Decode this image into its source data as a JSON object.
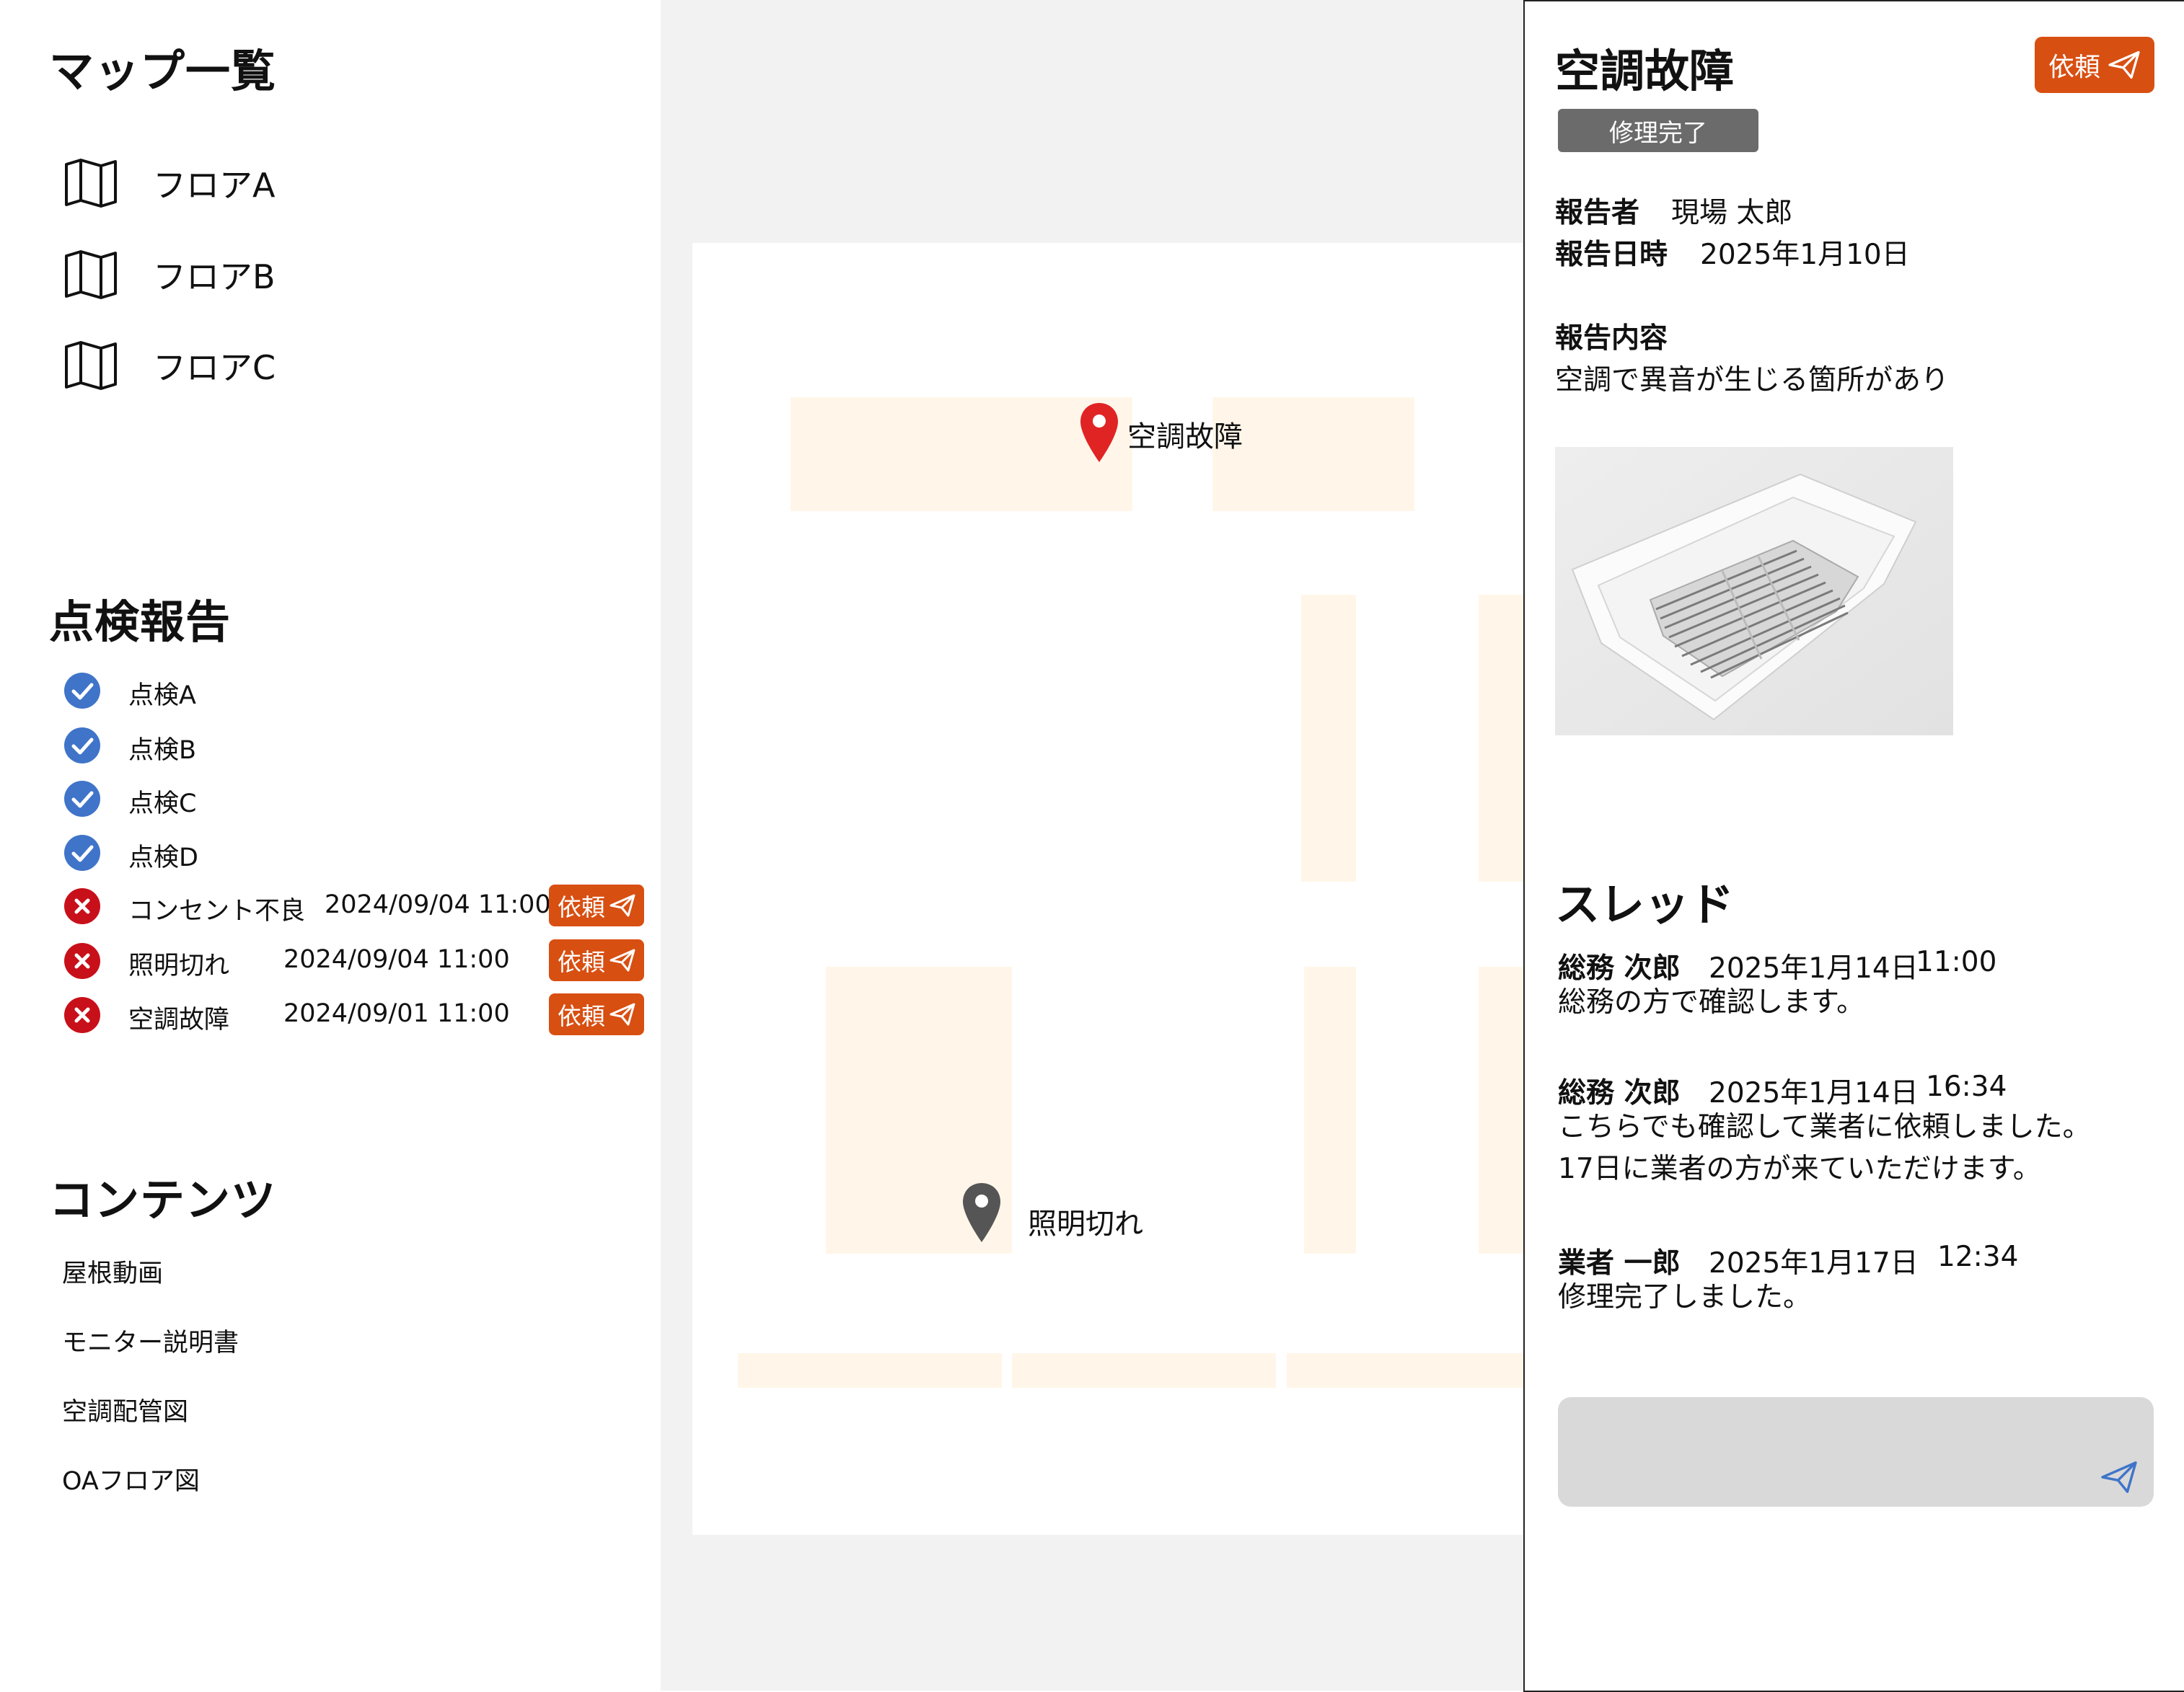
{
  "sidebar": {
    "map_title": "マップ一覧",
    "maps": [
      {
        "label": "フロアA",
        "icon": "map-icon"
      },
      {
        "label": "フロアB",
        "icon": "map-icon"
      },
      {
        "label": "フロアC",
        "icon": "map-icon"
      }
    ],
    "inspection_title": "点検報告",
    "inspections": [
      {
        "name": "点検A",
        "status": "ok"
      },
      {
        "name": "点検B",
        "status": "ok"
      },
      {
        "name": "点検C",
        "status": "ok"
      },
      {
        "name": "点検D",
        "status": "ok"
      },
      {
        "name": "コンセント不良",
        "status": "ng",
        "datetime": "2024/09/04 11:00",
        "button": "依頼"
      },
      {
        "name": "照明切れ",
        "status": "ng",
        "datetime": "2024/09/04 11:00",
        "button": "依頼"
      },
      {
        "name": "空調故障",
        "status": "ng",
        "datetime": "2024/09/01 11:00",
        "button": "依頼"
      }
    ],
    "contents_title": "コンテンツ",
    "contents": [
      "屋根動画",
      "モニター説明書",
      "空調配管図",
      "OAフロア図"
    ]
  },
  "map": {
    "pins": [
      {
        "label": "空調故障",
        "color": "#e02424"
      },
      {
        "label": "照明切れ",
        "color": "#555555"
      }
    ],
    "room_color": "#fff6e9",
    "background": "#f2f2f2"
  },
  "detail": {
    "title": "空調故障",
    "request_button": "依頼",
    "status_badge": "修理完了",
    "reporter_label": "報告者",
    "reporter": "現場 太郎",
    "date_label": "報告日時",
    "date": "2025年1月10日",
    "content_label": "報告内容",
    "content": "空調で異音が生じる箇所があり",
    "photo_icon": "ceiling-air-conditioner-photo",
    "thread_title": "スレッド",
    "thread": [
      {
        "name": "総務 次郎",
        "date": "2025年1月14日",
        "time": "11:00",
        "lines": [
          "総務の方で確認します。"
        ]
      },
      {
        "name": "総務 次郎",
        "date": "2025年1月14日",
        "time": "16:34",
        "lines": [
          "こちらでも確認して業者に依頼しました。",
          "17日に業者の方が来ていただけます。"
        ]
      },
      {
        "name": "業者 一郎",
        "date": "2025年1月17日",
        "time": "12:34",
        "lines": [
          "修理完了しました。"
        ]
      }
    ],
    "reply_placeholder": "",
    "accent_color": "#d84f12",
    "badge_color": "#6b6b6b"
  }
}
